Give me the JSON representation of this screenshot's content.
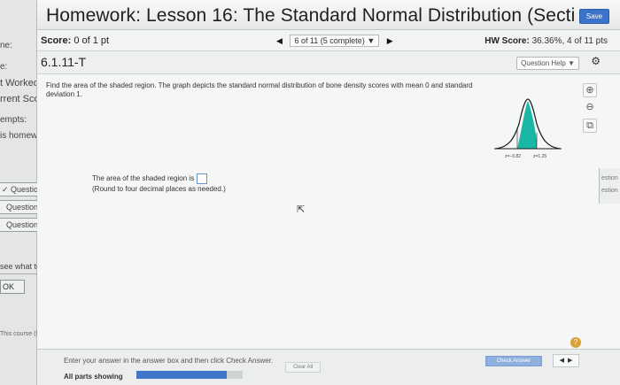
{
  "header": {
    "title": "Homework: Lesson 16: The Standard Normal Distribution (Secti",
    "save_label": "Save"
  },
  "scorebar": {
    "score_label": "Score:",
    "score_value": "0 of 1 pt",
    "pager_text": "6 of 11 (5 complete)",
    "hw_score_label": "HW Score:",
    "hw_score_value": "36.36%, 4 of 11 pts"
  },
  "question": {
    "number": "6.1.11-T",
    "help_label": "Question Help",
    "prompt": "Find the area of the shaded region. The graph depicts the standard normal distribution of bone density scores with mean 0 and standard deviation 1.",
    "answer_label": "The area of the shaded region is",
    "answer_hint": "(Round to four decimal places as needed.)",
    "answer_value": ""
  },
  "graph": {
    "left_label": "z=−0.82",
    "right_label": "z=1.25",
    "shade_color": "#19b8a6"
  },
  "sidebar": {
    "items": [
      "ne:",
      "e:",
      "t Worked",
      "rrent Scor",
      "empts:",
      "is homew"
    ],
    "question_links": [
      "Question",
      "Question",
      "Question"
    ],
    "see_what": "see what to",
    "ok_label": "OK",
    "course_text": "This course (MAT"
  },
  "rightstrip": {
    "lines": [
      "estion",
      "estion"
    ]
  },
  "footer": {
    "instruction": "Enter your answer in the answer box and then click Check Answer.",
    "all_parts": "All parts showing",
    "progress": 0.85,
    "clear_all": "Clear All",
    "check_answer": "Check Answer",
    "help_icon": "?"
  },
  "colors": {
    "save_button": "#3a73c9",
    "progress_fill": "#3f78c8",
    "shaded_region": "#19b8a6"
  }
}
